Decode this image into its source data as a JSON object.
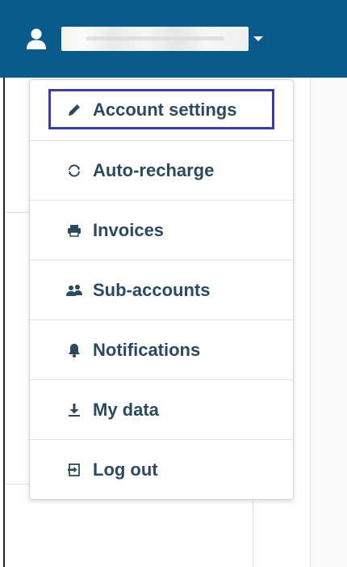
{
  "header": {
    "user_icon": "user-icon",
    "user_name_redacted": true,
    "dropdown_icon": "caret-down-icon",
    "bar_color": "#0a5a8c"
  },
  "menu": {
    "items": [
      {
        "label": "Account settings",
        "icon": "pencil-icon",
        "focused": true
      },
      {
        "label": "Auto-recharge",
        "icon": "sync-icon"
      },
      {
        "label": "Invoices",
        "icon": "printer-icon"
      },
      {
        "label": "Sub-accounts",
        "icon": "users-icon"
      },
      {
        "label": "Notifications",
        "icon": "bell-icon"
      },
      {
        "label": "My data",
        "icon": "download-icon"
      },
      {
        "label": "Log out",
        "icon": "sign-out-icon"
      }
    ],
    "text_color": "#2c4a5e",
    "focus_color": "#3a3aa8"
  }
}
